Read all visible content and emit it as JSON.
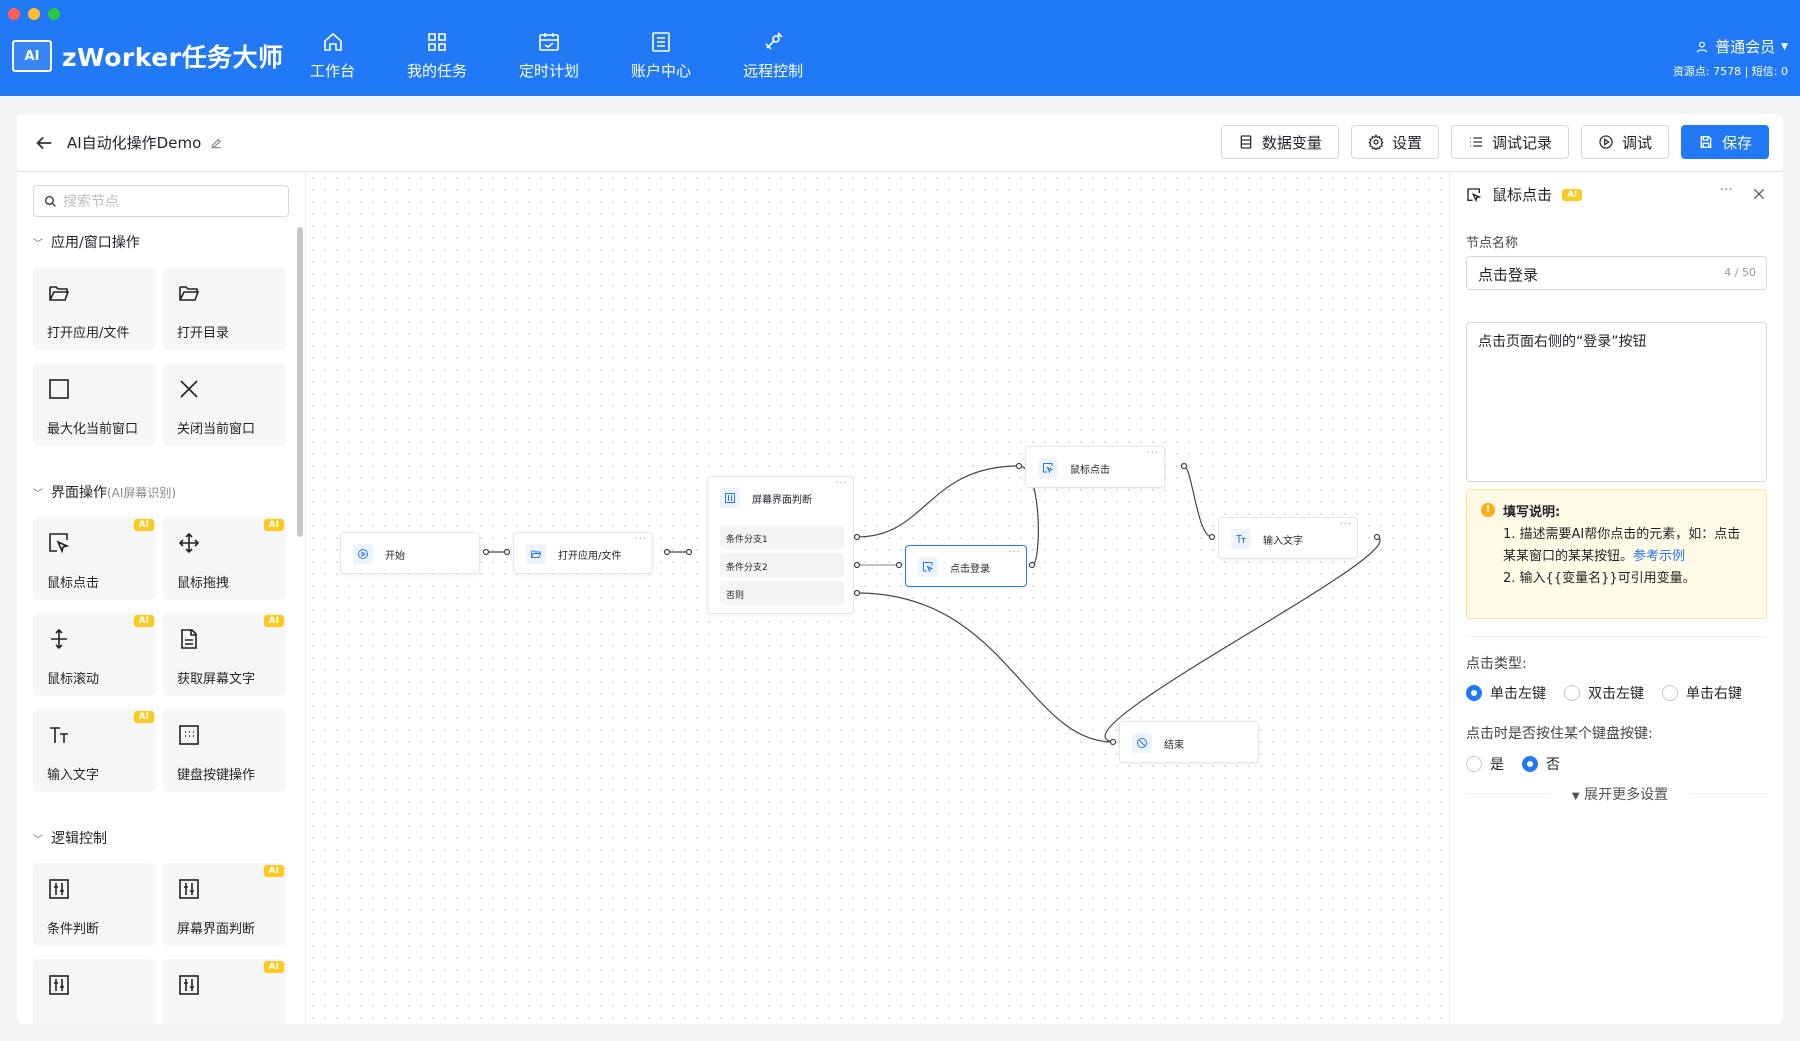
{
  "app": {
    "brand": "zWorker任务大师",
    "logo_mark": "AI"
  },
  "nav": [
    {
      "label": "工作台",
      "icon": "home-icon"
    },
    {
      "label": "我的任务",
      "icon": "apps-icon"
    },
    {
      "label": "定时计划",
      "icon": "calendar-icon"
    },
    {
      "label": "账户中心",
      "icon": "list-icon"
    },
    {
      "label": "远程控制",
      "icon": "satellite-icon"
    }
  ],
  "user": {
    "name": "普通会员",
    "stats": "资源点: 7578 | 短信: 0"
  },
  "doc": {
    "title": "AI自动化操作Demo"
  },
  "toolbar": {
    "variables": "数据变量",
    "settings": "设置",
    "debug_log": "调试记录",
    "debug": "调试",
    "save": "保存"
  },
  "sidebar": {
    "search_placeholder": "搜索节点",
    "sections": [
      {
        "title": "应用/窗口操作",
        "sub": ""
      },
      {
        "title": "界面操作",
        "sub": "(AI屏幕识别)"
      },
      {
        "title": "逻辑控制",
        "sub": ""
      }
    ],
    "cards": [
      {
        "label": "打开应用/文件",
        "ai": false,
        "icon": "folder-open-icon"
      },
      {
        "label": "打开目录",
        "ai": false,
        "icon": "folder-open-icon"
      },
      {
        "label": "最大化当前窗口",
        "ai": false,
        "icon": "square-icon"
      },
      {
        "label": "关闭当前窗口",
        "ai": false,
        "icon": "close-icon"
      },
      {
        "label": "鼠标点击",
        "ai": true,
        "icon": "cursor-click-icon"
      },
      {
        "label": "鼠标拖拽",
        "ai": true,
        "icon": "move-icon"
      },
      {
        "label": "鼠标滚动",
        "ai": true,
        "icon": "scroll-icon"
      },
      {
        "label": "获取屏幕文字",
        "ai": true,
        "icon": "document-icon"
      },
      {
        "label": "输入文字",
        "ai": true,
        "icon": "text-icon"
      },
      {
        "label": "键盘按键操作",
        "ai": false,
        "icon": "keyboard-icon"
      },
      {
        "label": "条件判断",
        "ai": false,
        "icon": "sliders-icon"
      },
      {
        "label": "屏幕界面判断",
        "ai": true,
        "icon": "sliders-icon"
      },
      {
        "label": "",
        "ai": false,
        "icon": "sliders-icon"
      },
      {
        "label": "",
        "ai": true,
        "icon": "sliders-icon"
      }
    ],
    "ai_badge": "AI"
  },
  "flow": {
    "nodes": {
      "start": "开始",
      "open_app": "打开应用/文件",
      "screen_judge": "屏幕界面判断",
      "branch1": "条件分支1",
      "branch2": "条件分支2",
      "else": "否则",
      "click_login": "点击登录",
      "mouse_click": "鼠标点击",
      "input_text": "输入文字",
      "end": "结束"
    },
    "more": "···"
  },
  "panel": {
    "title": "鼠标点击",
    "ai_badge": "AI",
    "more": "···",
    "node_name_label": "节点名称",
    "node_name": "点击登录",
    "node_name_count": "4 / 50",
    "description": "点击页面右侧的“登录”按钮",
    "tip_title": "填写说明:",
    "tip_line1_a": "1. 描述需要AI帮你点击的元素，如：点击某某窗口的某某按钮。",
    "tip_line1_link": "参考示例",
    "tip_line2": "2. 输入{{变量名}}可引用变量。",
    "click_type_label": "点击类型:",
    "click_types": [
      {
        "label": "单击左键",
        "selected": true
      },
      {
        "label": "双击左键",
        "selected": false
      },
      {
        "label": "单击右键",
        "selected": false
      }
    ],
    "hold_key_label": "点击时是否按住某个键盘按键:",
    "hold_key_options": [
      {
        "label": "是",
        "selected": false
      },
      {
        "label": "否",
        "selected": true
      }
    ],
    "expand_more": "展开更多设置"
  }
}
